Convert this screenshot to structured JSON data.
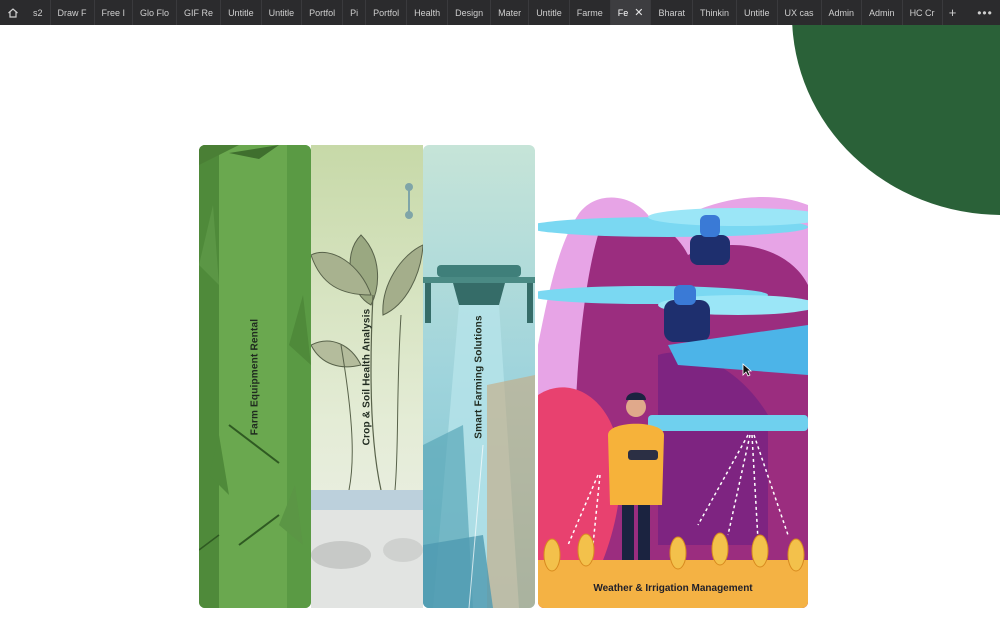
{
  "browser": {
    "home_icon": "home-icon",
    "tabs": [
      {
        "label": "s2",
        "active": false
      },
      {
        "label": "Draw F",
        "active": false
      },
      {
        "label": "Free I",
        "active": false
      },
      {
        "label": "Glo Flo",
        "active": false
      },
      {
        "label": "GIF Re",
        "active": false
      },
      {
        "label": "Untitle",
        "active": false
      },
      {
        "label": "Untitle",
        "active": false
      },
      {
        "label": "Portfol",
        "active": false
      },
      {
        "label": "Pi",
        "active": false
      },
      {
        "label": "Portfol",
        "active": false
      },
      {
        "label": "Health",
        "active": false
      },
      {
        "label": "Design",
        "active": false
      },
      {
        "label": "Mater",
        "active": false
      },
      {
        "label": "Untitle",
        "active": false
      },
      {
        "label": "Farme",
        "active": false
      },
      {
        "label": "Fe",
        "active": true
      },
      {
        "label": "Bharat",
        "active": false
      },
      {
        "label": "Thinkin",
        "active": false
      },
      {
        "label": "Untitle",
        "active": false
      },
      {
        "label": "UX cas",
        "active": false
      },
      {
        "label": "Admin",
        "active": false
      },
      {
        "label": "Admin",
        "active": false
      },
      {
        "label": "HC Cr",
        "active": false
      }
    ],
    "close_glyph": "✕",
    "new_tab_glyph": "+",
    "more_glyph": "•••"
  },
  "panels": [
    {
      "label": "Farm Equipment Rental"
    },
    {
      "label": "Crop & Soil Health Analysis"
    },
    {
      "label": "Smart Farming Solutions"
    },
    {
      "label": "Weather & Irrigation Management"
    }
  ],
  "colors": {
    "tabbar_bg": "#2b2b2d",
    "blob_green": "#2a6138",
    "panel1_green": "#6aa84f",
    "panel2_sage": "#c9d8b0",
    "panel3_teal": "#8fd3d6",
    "panel4_magenta": "#c2185b"
  }
}
